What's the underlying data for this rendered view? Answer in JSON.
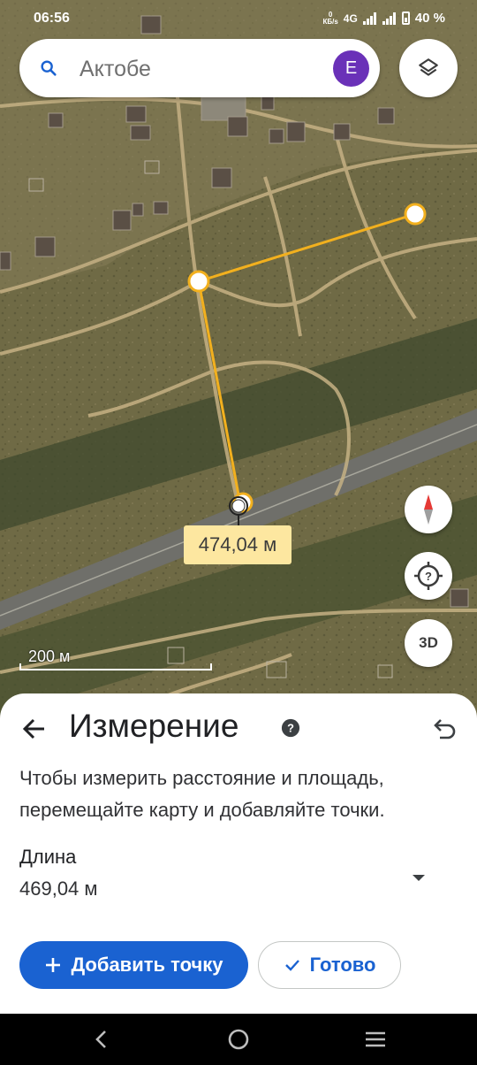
{
  "status": {
    "time": "06:56",
    "speed_value": "0",
    "speed_unit": "КБ/s",
    "network": "4G",
    "battery": "40 %"
  },
  "search": {
    "placeholder": "Актобе",
    "avatar_letter": "E"
  },
  "map": {
    "measure_label": "474,04 м",
    "scale_label": "200 м",
    "compass_button": "compass-icon",
    "location_button": "my-location-icon",
    "view_3d_label": "3D"
  },
  "sheet": {
    "title": "Измерение",
    "description": "Чтобы измерить расстояние и площадь, перемещайте карту и добавляйте точки.",
    "length_label": "Длина",
    "length_value": "469,04 м",
    "add_point_label": "Добавить точку",
    "done_label": "Готово"
  },
  "colors": {
    "accent": "#1a62d1",
    "measure_line": "#f2b01e",
    "avatar": "#6a31b8"
  },
  "icons": [
    "search-icon",
    "layers-icon",
    "compass-icon",
    "my-location-icon",
    "back-arrow-icon",
    "help-icon",
    "undo-icon",
    "dropdown-icon",
    "plus-icon",
    "check-icon",
    "nav-back-icon",
    "nav-home-icon",
    "nav-recents-icon"
  ]
}
